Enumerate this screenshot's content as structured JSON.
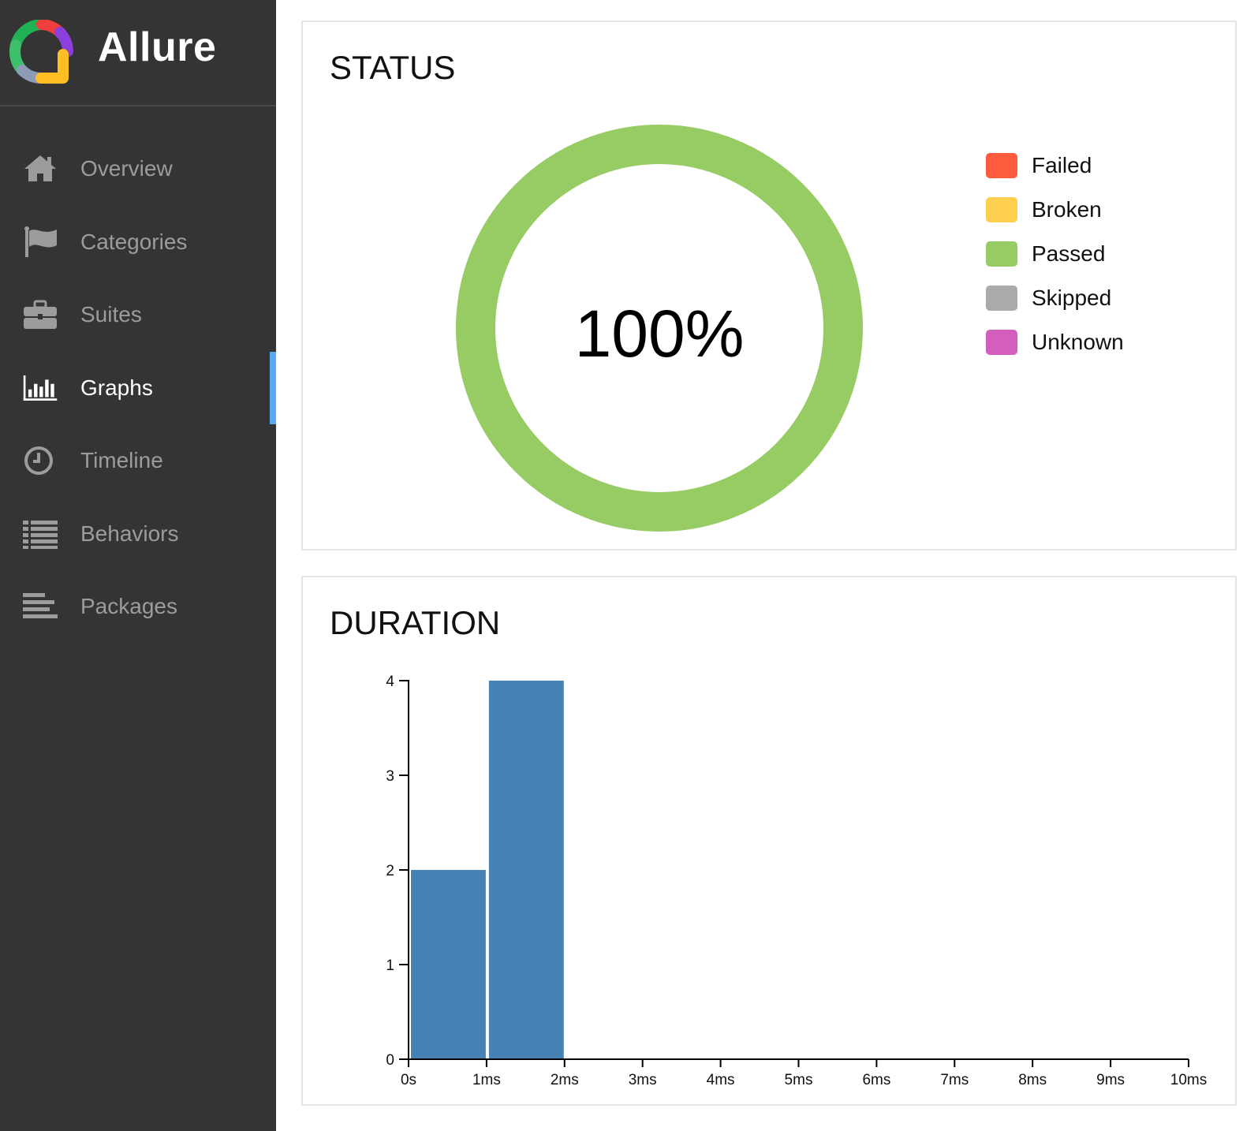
{
  "app": {
    "name": "Allure"
  },
  "sidebar": {
    "items": [
      {
        "label": "Overview",
        "icon": "home-icon",
        "active": false
      },
      {
        "label": "Categories",
        "icon": "flag-icon",
        "active": false
      },
      {
        "label": "Suites",
        "icon": "briefcase-icon",
        "active": false
      },
      {
        "label": "Graphs",
        "icon": "bar-chart-icon",
        "active": true
      },
      {
        "label": "Timeline",
        "icon": "clock-icon",
        "active": false
      },
      {
        "label": "Behaviors",
        "icon": "list-icon",
        "active": false
      },
      {
        "label": "Packages",
        "icon": "align-left-icon",
        "active": false
      }
    ]
  },
  "status": {
    "title": "STATUS",
    "percent_label": "100%",
    "legend": [
      {
        "label": "Failed",
        "color": "#fd5a3e"
      },
      {
        "label": "Broken",
        "color": "#ffd050"
      },
      {
        "label": "Passed",
        "color": "#97cc64"
      },
      {
        "label": "Skipped",
        "color": "#aaaaaa"
      },
      {
        "label": "Unknown",
        "color": "#d35ebe"
      }
    ],
    "chart_data": {
      "type": "pie",
      "slices": [
        {
          "name": "Passed",
          "value": 100,
          "color": "#97cc64"
        }
      ]
    }
  },
  "duration": {
    "title": "DURATION",
    "chart_data": {
      "type": "bar",
      "x_ticks": [
        "0s",
        "1ms",
        "2ms",
        "3ms",
        "4ms",
        "5ms",
        "6ms",
        "7ms",
        "8ms",
        "9ms",
        "10ms"
      ],
      "y_ticks": [
        "0",
        "1",
        "2",
        "3",
        "4"
      ],
      "ylim": [
        0,
        4
      ],
      "xlim_ms": [
        0,
        10
      ],
      "bins": [
        {
          "from_ms": 0,
          "to_ms": 1,
          "value": 2
        },
        {
          "from_ms": 1,
          "to_ms": 2,
          "value": 4
        }
      ],
      "bar_color": "#4682b4"
    }
  }
}
